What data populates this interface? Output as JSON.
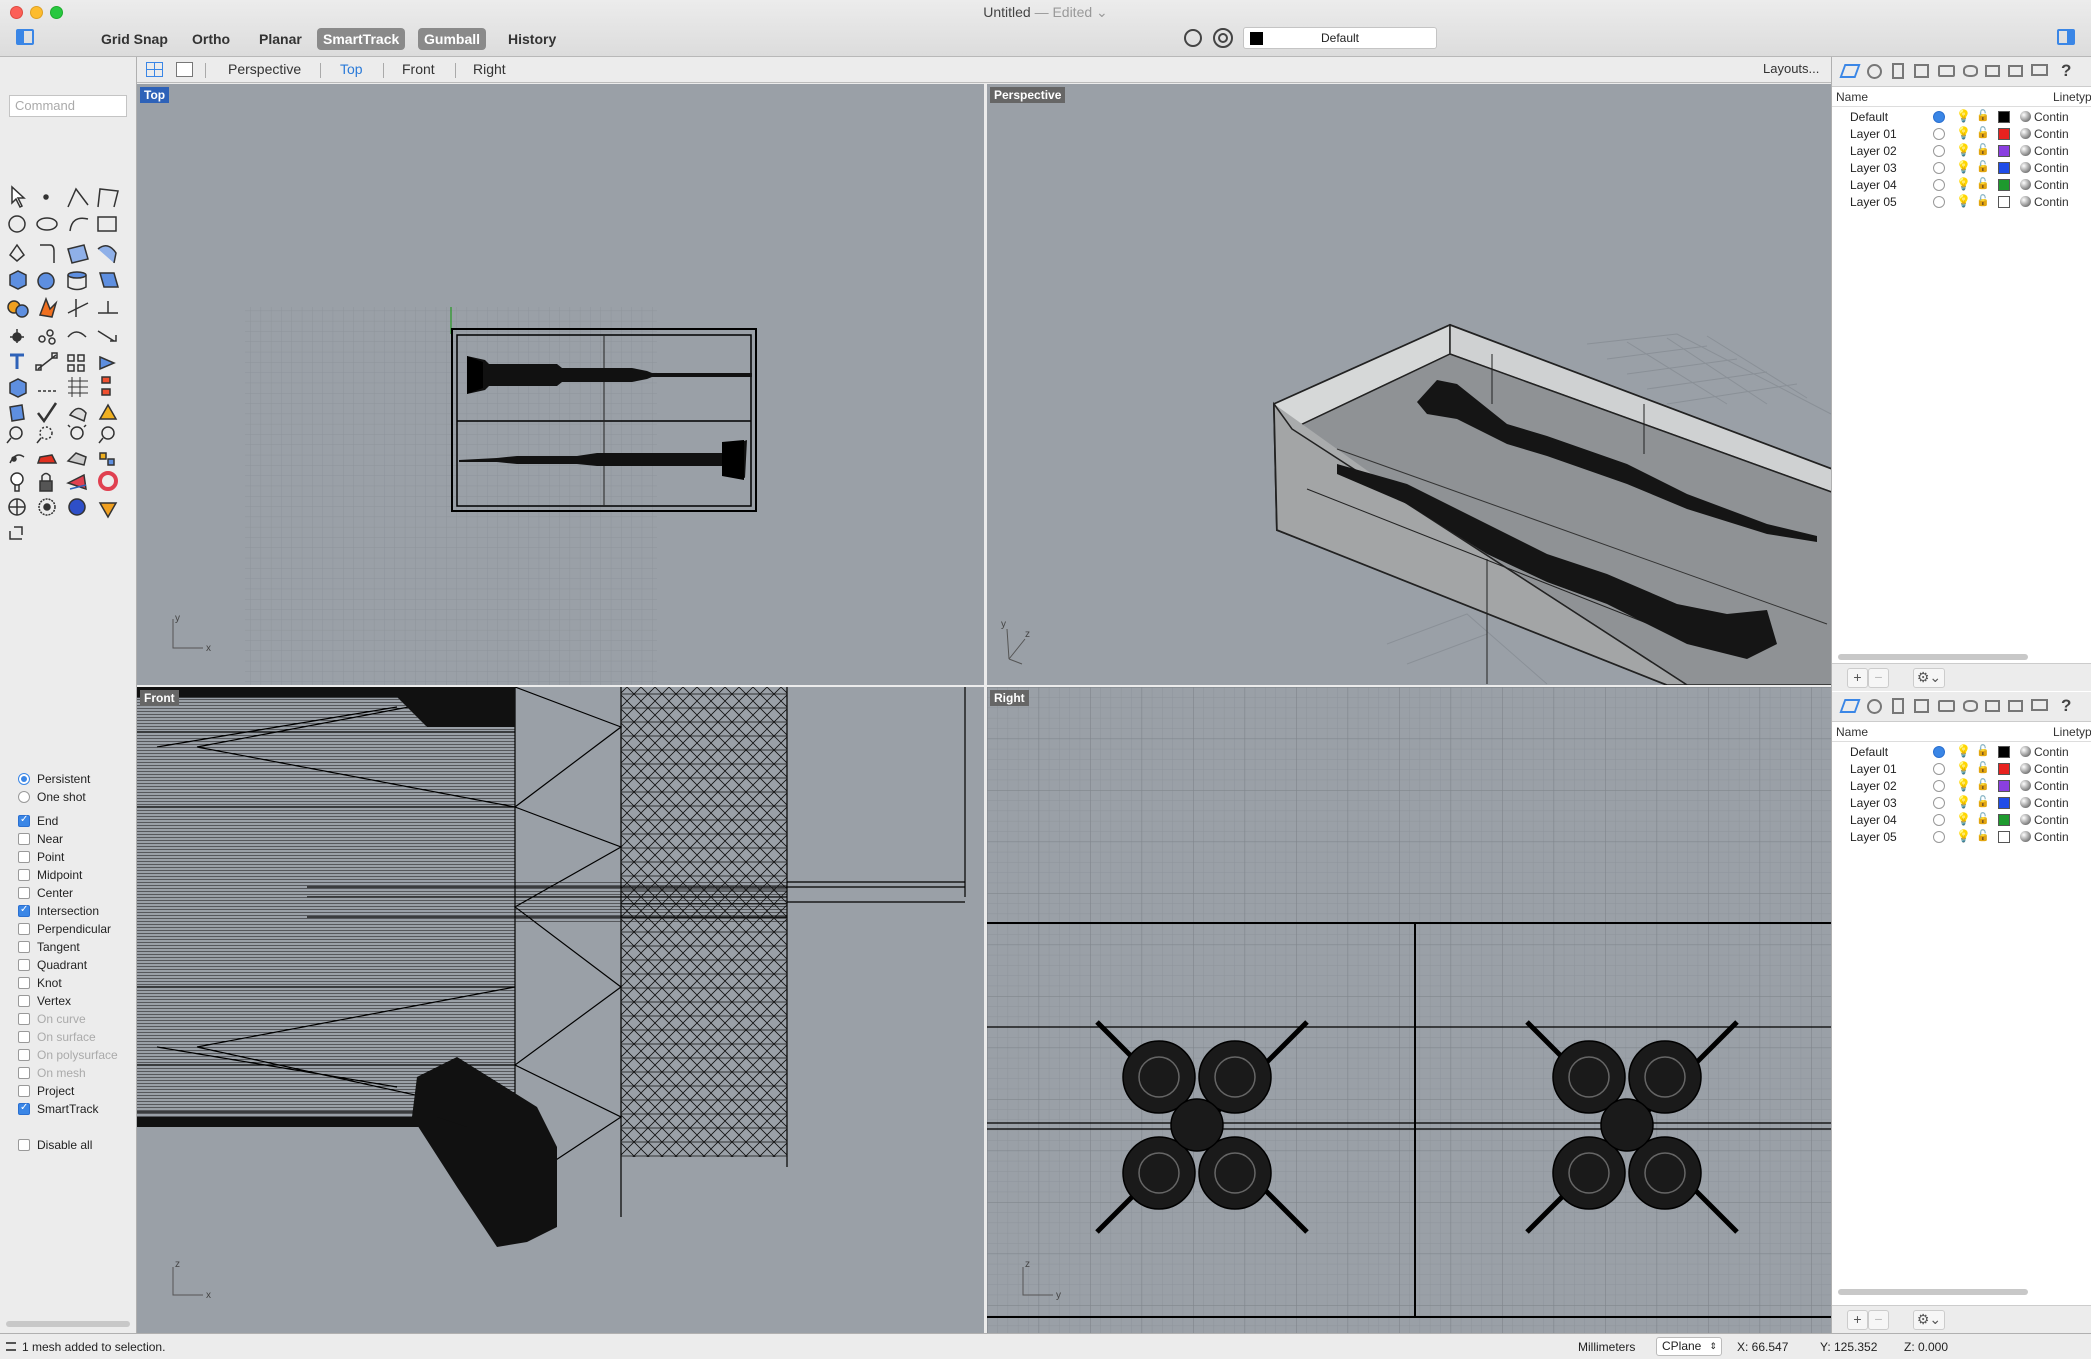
{
  "window": {
    "title": "Untitled",
    "edited": "— Edited"
  },
  "toolbar": {
    "grid_snap": "Grid Snap",
    "ortho": "Ortho",
    "planar": "Planar",
    "smarttrack": "SmartTrack",
    "gumball": "Gumball",
    "history": "History",
    "current_layer": "Default"
  },
  "tabs": {
    "perspective": "Perspective",
    "top": "Top",
    "front": "Front",
    "right": "Right",
    "layouts": "Layouts..."
  },
  "command": {
    "placeholder": "Command"
  },
  "viewports": {
    "top": "Top",
    "perspective": "Perspective",
    "front": "Front",
    "right": "Right"
  },
  "osnap": {
    "persistent": "Persistent",
    "one_shot": "One shot",
    "end": "End",
    "near": "Near",
    "point": "Point",
    "midpoint": "Midpoint",
    "center": "Center",
    "intersection": "Intersection",
    "perpendicular": "Perpendicular",
    "tangent": "Tangent",
    "quadrant": "Quadrant",
    "knot": "Knot",
    "vertex": "Vertex",
    "on_curve": "On curve",
    "on_surface": "On surface",
    "on_polysurface": "On polysurface",
    "on_mesh": "On mesh",
    "project": "Project",
    "smarttrack": "SmartTrack",
    "disable_all": "Disable all"
  },
  "layers": {
    "col_name": "Name",
    "col_linetype": "Linetyp",
    "rows": [
      {
        "name": "Default",
        "color": "#000000",
        "linetype": "Contin"
      },
      {
        "name": "Layer 01",
        "color": "#e8221f",
        "linetype": "Contin"
      },
      {
        "name": "Layer 02",
        "color": "#8a3fe0",
        "linetype": "Contin"
      },
      {
        "name": "Layer 03",
        "color": "#1f4ce8",
        "linetype": "Contin"
      },
      {
        "name": "Layer 04",
        "color": "#1e9a2e",
        "linetype": "Contin"
      },
      {
        "name": "Layer 05",
        "color": "#ffffff",
        "linetype": "Contin"
      }
    ]
  },
  "status": {
    "message": "1 mesh added to selection.",
    "units": "Millimeters",
    "cplane": "CPlane",
    "x": "X: 66.547",
    "y": "Y: 125.352",
    "z": "Z: 0.000"
  }
}
